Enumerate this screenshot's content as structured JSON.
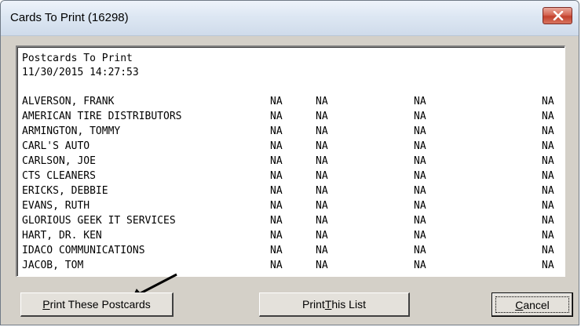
{
  "window": {
    "title": "Cards To Print (16298)",
    "close_glyph": "✕"
  },
  "report": {
    "heading": "Postcards To Print",
    "timestamp": "11/30/2015 14:27:53",
    "rows": [
      {
        "name": "ALVERSON, FRANK",
        "col1": "NA",
        "col2": "NA",
        "col3": "NA",
        "col4": "NA"
      },
      {
        "name": "AMERICAN TIRE DISTRIBUTORS",
        "col1": "NA",
        "col2": "NA",
        "col3": "NA",
        "col4": "NA"
      },
      {
        "name": "ARMINGTON, TOMMY",
        "col1": "NA",
        "col2": "NA",
        "col3": "NA",
        "col4": "NA"
      },
      {
        "name": "CARL'S AUTO",
        "col1": "NA",
        "col2": "NA",
        "col3": "NA",
        "col4": "NA"
      },
      {
        "name": "CARLSON, JOE",
        "col1": "NA",
        "col2": "NA",
        "col3": "NA",
        "col4": "NA"
      },
      {
        "name": "CTS CLEANERS",
        "col1": "NA",
        "col2": "NA",
        "col3": "NA",
        "col4": "NA"
      },
      {
        "name": "ERICKS, DEBBIE",
        "col1": "NA",
        "col2": "NA",
        "col3": "NA",
        "col4": "NA"
      },
      {
        "name": "EVANS, RUTH",
        "col1": "NA",
        "col2": "NA",
        "col3": "NA",
        "col4": "NA"
      },
      {
        "name": "GLORIOUS GEEK IT SERVICES",
        "col1": "NA",
        "col2": "NA",
        "col3": "NA",
        "col4": "NA"
      },
      {
        "name": "HART, DR. KEN",
        "col1": "NA",
        "col2": "NA",
        "col3": "NA",
        "col4": "NA"
      },
      {
        "name": "IDACO COMMUNICATIONS",
        "col1": "NA",
        "col2": "NA",
        "col3": "NA",
        "col4": "NA"
      },
      {
        "name": "JACOB, TOM",
        "col1": "NA",
        "col2": "NA",
        "col3": "NA",
        "col4": "NA"
      }
    ]
  },
  "buttons": {
    "print_postcards": {
      "before": "",
      "mnemonic": "P",
      "after": "rint These Postcards"
    },
    "print_list": {
      "before": "Print ",
      "mnemonic": "T",
      "after": "his List"
    },
    "cancel": {
      "before": "",
      "mnemonic": "C",
      "after": "ancel"
    }
  },
  "annotation": {
    "arrow_color": "#000000"
  }
}
